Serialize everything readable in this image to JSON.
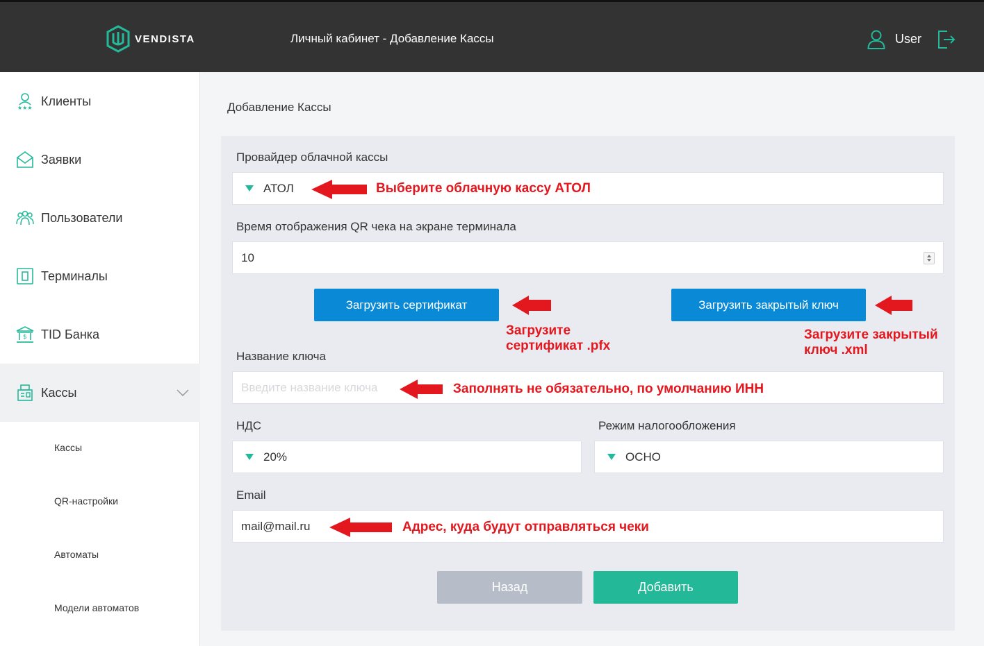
{
  "header": {
    "logo_text": "VENDISTA",
    "title": "Личный кабинет - Добавление Кассы",
    "user_name": "User"
  },
  "sidebar": {
    "items": [
      {
        "label": "Клиенты",
        "icon": "clients-icon"
      },
      {
        "label": "Заявки",
        "icon": "requests-icon"
      },
      {
        "label": "Пользователи",
        "icon": "users-icon"
      },
      {
        "label": "Терминалы",
        "icon": "terminal-icon"
      },
      {
        "label": "TID Банка",
        "icon": "bank-icon"
      },
      {
        "label": "Кассы",
        "icon": "cashbox-icon"
      }
    ],
    "sub_items": [
      "Кассы",
      "QR-настройки",
      "Автоматы",
      "Модели автоматов"
    ]
  },
  "page": {
    "heading": "Добавление Кассы",
    "provider_label": "Провайдер облачной кассы",
    "provider_value": "АТОЛ",
    "qr_time_label": "Время отображения QR чека на экране терминала",
    "qr_time_value": "10",
    "upload_cert_button": "Загрузить сертификат",
    "upload_key_button": "Загрузить закрытый ключ",
    "key_name_label": "Название ключа",
    "key_name_placeholder": "Введите название ключа",
    "vat_label": "НДС",
    "vat_value": "20%",
    "tax_mode_label": "Режим налогообложения",
    "tax_mode_value": "ОСНО",
    "email_label": "Email",
    "email_value": "mail@mail.ru",
    "back_button": "Назад",
    "add_button": "Добавить"
  },
  "annotations": {
    "provider_note": "Выберите облачную кассу АТОЛ",
    "cert_note_line1": "Загрузите",
    "cert_note_line2": "сертификат .pfx",
    "key_note_line1": "Загрузите закрытый",
    "key_note_line2": "ключ .xml",
    "key_name_note": "Заполнять не обязательно, по умолчанию ИНН",
    "email_note": "Адрес, куда будут отправляться чеки"
  },
  "colors": {
    "topbar": "#333333",
    "accent_green": "#22b898",
    "button_blue": "#0a8ad6",
    "annotation_red": "#e3181f",
    "back_button": "#b6bcc8"
  }
}
